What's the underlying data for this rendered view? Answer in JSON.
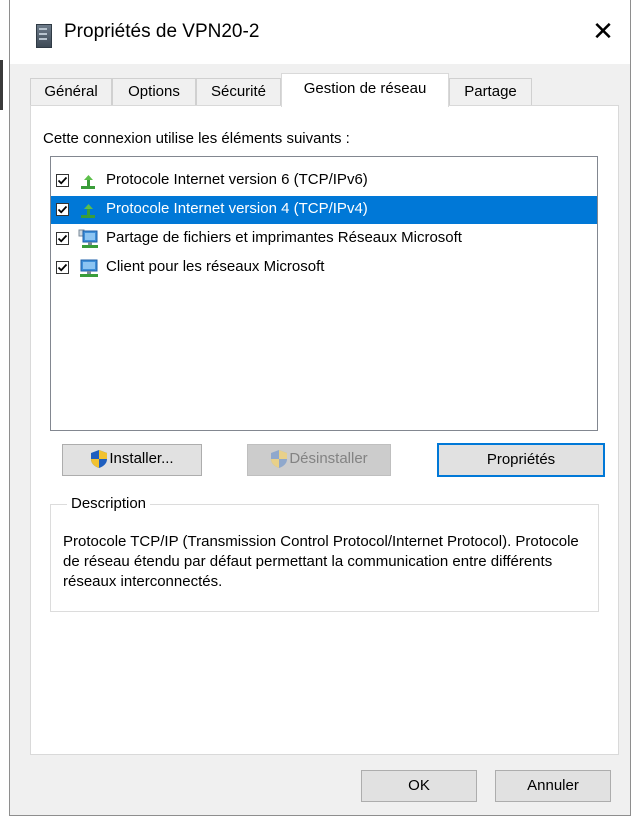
{
  "window": {
    "title": "Propriétés de VPN20-2",
    "close_glyph": "✕"
  },
  "tabs": [
    {
      "label": "Général"
    },
    {
      "label": "Options"
    },
    {
      "label": "Sécurité"
    },
    {
      "label": "Gestion de réseau",
      "active": true
    },
    {
      "label": "Partage"
    }
  ],
  "network": {
    "components_label": "Cette connexion utilise les éléments suivants :",
    "items": [
      {
        "label": "Protocole Internet version 6 (TCP/IPv6)",
        "checked": true,
        "icon": "protocol-icon"
      },
      {
        "label": "Protocole Internet version 4 (TCP/IPv4)",
        "checked": true,
        "selected": true,
        "icon": "protocol-icon"
      },
      {
        "label": "Partage de fichiers et imprimantes Réseaux Microsoft",
        "checked": true,
        "icon": "network-service-icon"
      },
      {
        "label": "Client pour les réseaux Microsoft",
        "checked": true,
        "icon": "network-client-icon"
      }
    ],
    "buttons": {
      "install": "Installer...",
      "uninstall": "Désinstaller",
      "properties": "Propriétés"
    },
    "description": {
      "title": "Description",
      "text": "Protocole TCP/IP (Transmission Control Protocol/Internet Protocol). Protocole de réseau étendu par défaut permettant la communication entre différents réseaux interconnectés."
    }
  },
  "footer": {
    "ok": "OK",
    "cancel": "Annuler"
  },
  "colors": {
    "selection": "#0078d7",
    "dialog_bg": "#f0f0f0"
  }
}
